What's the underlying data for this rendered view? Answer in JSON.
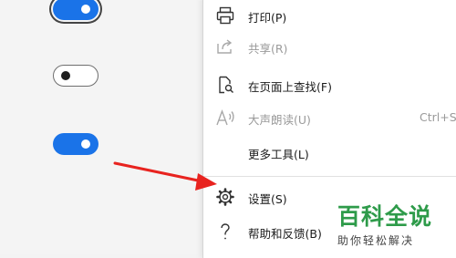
{
  "toggles": [
    {
      "state": "on",
      "focused": true
    },
    {
      "state": "off",
      "focused": false
    },
    {
      "state": "on",
      "focused": false
    }
  ],
  "menu": {
    "items": [
      {
        "label": "打印(P)",
        "icon": "printer-icon",
        "disabled": false
      },
      {
        "label": "共享(R)",
        "icon": "share-icon",
        "disabled": true
      },
      {
        "label": "在页面上查找(F)",
        "icon": "find-on-page-icon",
        "disabled": false
      },
      {
        "label": "大声朗读(U)",
        "icon": "read-aloud-icon",
        "disabled": true,
        "shortcut": "Ctrl+S"
      },
      {
        "label": "更多工具(L)",
        "icon": "",
        "disabled": false
      },
      {
        "label": "设置(S)",
        "icon": "gear-icon",
        "disabled": false
      },
      {
        "label": "帮助和反馈(B)",
        "icon": "question-icon",
        "disabled": false
      }
    ]
  },
  "annotation": {
    "arrow_color": "#e8231f",
    "target": "设置(S)"
  },
  "watermark": {
    "title": "百科全说",
    "subtitle": "助你轻松解决",
    "color": "#2e9b4a"
  }
}
